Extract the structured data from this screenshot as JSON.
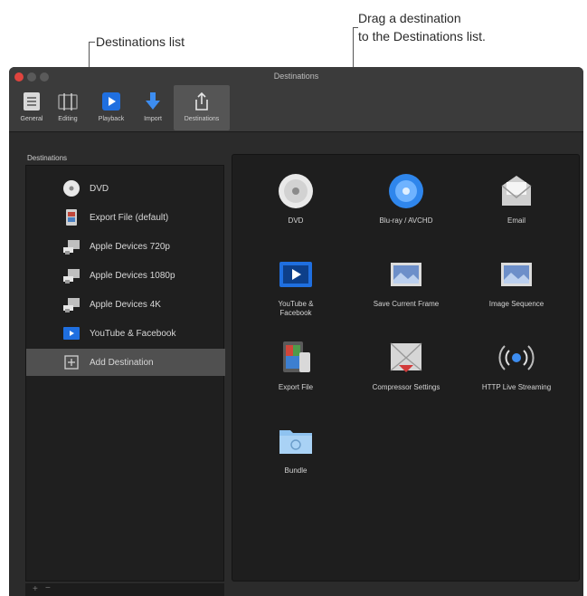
{
  "callouts": {
    "left": "Destinations list",
    "right_line1": "Drag a destination",
    "right_line2": "to the Destinations list."
  },
  "window": {
    "title": "Destinations",
    "toolbar": [
      {
        "label": "General",
        "icon": "general-icon"
      },
      {
        "label": "Editing",
        "icon": "editing-icon"
      },
      {
        "label": "Playback",
        "icon": "playback-icon"
      },
      {
        "label": "Import",
        "icon": "import-icon"
      },
      {
        "label": "Destinations",
        "icon": "share-icon"
      }
    ]
  },
  "sidebar": {
    "header": "Destinations",
    "items": [
      {
        "label": "DVD",
        "icon": "dvd-icon"
      },
      {
        "label": "Export File (default)",
        "icon": "export-file-icon"
      },
      {
        "label": "Apple Devices 720p",
        "icon": "apple-devices-icon"
      },
      {
        "label": "Apple Devices 1080p",
        "icon": "apple-devices-icon"
      },
      {
        "label": "Apple Devices 4K",
        "icon": "apple-devices-icon"
      },
      {
        "label": "YouTube & Facebook",
        "icon": "youtube-facebook-icon"
      },
      {
        "label": "Add Destination",
        "icon": "add-destination-icon"
      }
    ],
    "selected_index": 6,
    "footer": {
      "add": "+",
      "remove": "−"
    }
  },
  "destinations": [
    {
      "label": "DVD",
      "icon": "dvd-icon"
    },
    {
      "label": "Blu-ray / AVCHD",
      "icon": "bluray-icon"
    },
    {
      "label": "Email",
      "icon": "email-icon"
    },
    {
      "label": "YouTube & Facebook",
      "icon": "youtube-facebook-icon"
    },
    {
      "label": "Save Current Frame",
      "icon": "save-frame-icon"
    },
    {
      "label": "Image Sequence",
      "icon": "image-sequence-icon"
    },
    {
      "label": "Export File",
      "icon": "export-file-icon"
    },
    {
      "label": "Compressor Settings",
      "icon": "compressor-icon"
    },
    {
      "label": "HTTP Live Streaming",
      "icon": "http-streaming-icon"
    },
    {
      "label": "Bundle",
      "icon": "bundle-icon"
    }
  ],
  "colors": {
    "window_bg": "#2b2b2b",
    "panel_bg": "#1e1e1e",
    "selection": "#505050",
    "accent_blue": "#1f6fe0"
  }
}
